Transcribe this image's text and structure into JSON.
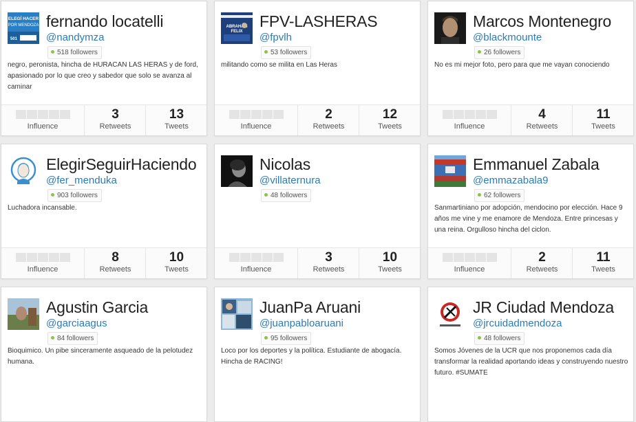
{
  "stat_labels": {
    "influence": "Influence",
    "retweets": "Retweets",
    "tweets": "Tweets"
  },
  "cards": [
    {
      "avatar_icon": "elegi-hacer-poster-avatar",
      "name": "fernando locatelli",
      "handle": "@nandymza",
      "followers": "518 followers",
      "bio": "negro, peronista, hincha de HURACAN LAS HERAS y de ford, apasionado por lo que creo y sabedor que solo se avanza al caminar",
      "avatar_text": "ELEGÍ HACER POR MENDOZA",
      "retweets": "3",
      "tweets": "13"
    },
    {
      "avatar_icon": "campaign-poster-avatar",
      "name": "FPV-LASHERAS",
      "handle": "@fpvlh",
      "followers": "53 followers",
      "bio": "militando como se milita en Las Heras",
      "avatar_text": "ABRAHAM FELIX",
      "retweets": "2",
      "tweets": "12"
    },
    {
      "avatar_icon": "portrait-photo-avatar",
      "name": "Marcos Montenegro",
      "handle": "@blackmounte",
      "followers": "26 followers",
      "bio": "No es mi mejor foto, pero para que me vayan conociendo",
      "retweets": "4",
      "tweets": "11"
    },
    {
      "avatar_icon": "illustrated-woman-avatar",
      "name": "ElegirSeguirHaciendo",
      "handle": "@fer_menduka",
      "followers": "903 followers",
      "bio": "Luchadora incansable.",
      "retweets": "8",
      "tweets": "10"
    },
    {
      "avatar_icon": "bw-portrait-avatar",
      "name": "Nicolas",
      "handle": "@villaternura",
      "followers": "48 followers",
      "bio": "",
      "retweets": "3",
      "tweets": "10"
    },
    {
      "avatar_icon": "stadium-photo-avatar",
      "name": "Emmanuel Zabala",
      "handle": "@emmazabala9",
      "followers": "62 followers",
      "bio": "Sanmartiniano por adopción, mendocino por elección. Hace 9 años me vine y me enamore de Mendoza. Entre princesas y una reina. Orgulloso hincha del ciclon.",
      "retweets": "2",
      "tweets": "11"
    },
    {
      "avatar_icon": "outdoor-photo-avatar",
      "name": "Agustin Garcia",
      "handle": "@garciaagus",
      "followers": "84 followers",
      "bio": "Bioquimico. Un pibe sinceramente asqueado de la pelotudez humana.",
      "retweets": "",
      "tweets": ""
    },
    {
      "avatar_icon": "collage-photo-avatar",
      "name": "JuanPa Aruani",
      "handle": "@juanpabloaruani",
      "followers": "95 followers",
      "bio": "Loco por los deportes y la política. Estudiante de abogacía. Hincha de RACING!",
      "retweets": "",
      "tweets": ""
    },
    {
      "avatar_icon": "emblem-logo-avatar",
      "name": "JR Ciudad Mendoza",
      "handle": "@jrcuidadmendoza",
      "followers": "48 followers",
      "bio": "Somos Jóvenes de la UCR que nos proponemos cada día transformar la realidad aportando ideas y construyendo nuestro futuro. #SUMATE",
      "retweets": "",
      "tweets": ""
    }
  ]
}
